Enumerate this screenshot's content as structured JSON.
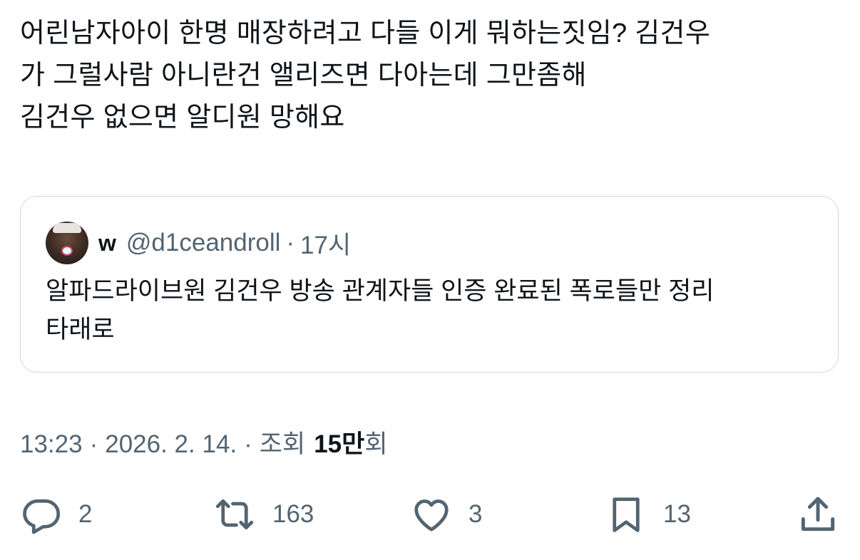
{
  "tweet": {
    "lines": [
      "어린남자아이 한명 매장하려고 다들 이게 뭐하는짓임? 김건우",
      "가 그럴사람 아니란건 앨리즈면 다아는데 그만좀해",
      "김건우 없으면 알디원 망해요"
    ]
  },
  "quote": {
    "name": "w",
    "handle": "@d1ceandroll",
    "separator": "·",
    "time": "17시",
    "lines": [
      "알파드라이브원 김건우 방송 관계자들 인증 완료된 폭로들만 정리",
      "타래로"
    ]
  },
  "meta": {
    "time": "13:23",
    "separator": "·",
    "date": "2026. 2. 14.",
    "views_label": "조회",
    "views_count": "15만",
    "views_suffix": "회"
  },
  "actions": {
    "reply": {
      "icon": "reply-icon",
      "count": "2"
    },
    "retweet": {
      "icon": "retweet-icon",
      "count": "163"
    },
    "like": {
      "icon": "heart-icon",
      "count": "3"
    },
    "bookmark": {
      "icon": "bookmark-icon",
      "count": "13"
    },
    "share": {
      "icon": "share-icon"
    }
  },
  "colors": {
    "text_primary": "#0f1419",
    "text_secondary": "#536471",
    "border": "#cfd9de"
  }
}
